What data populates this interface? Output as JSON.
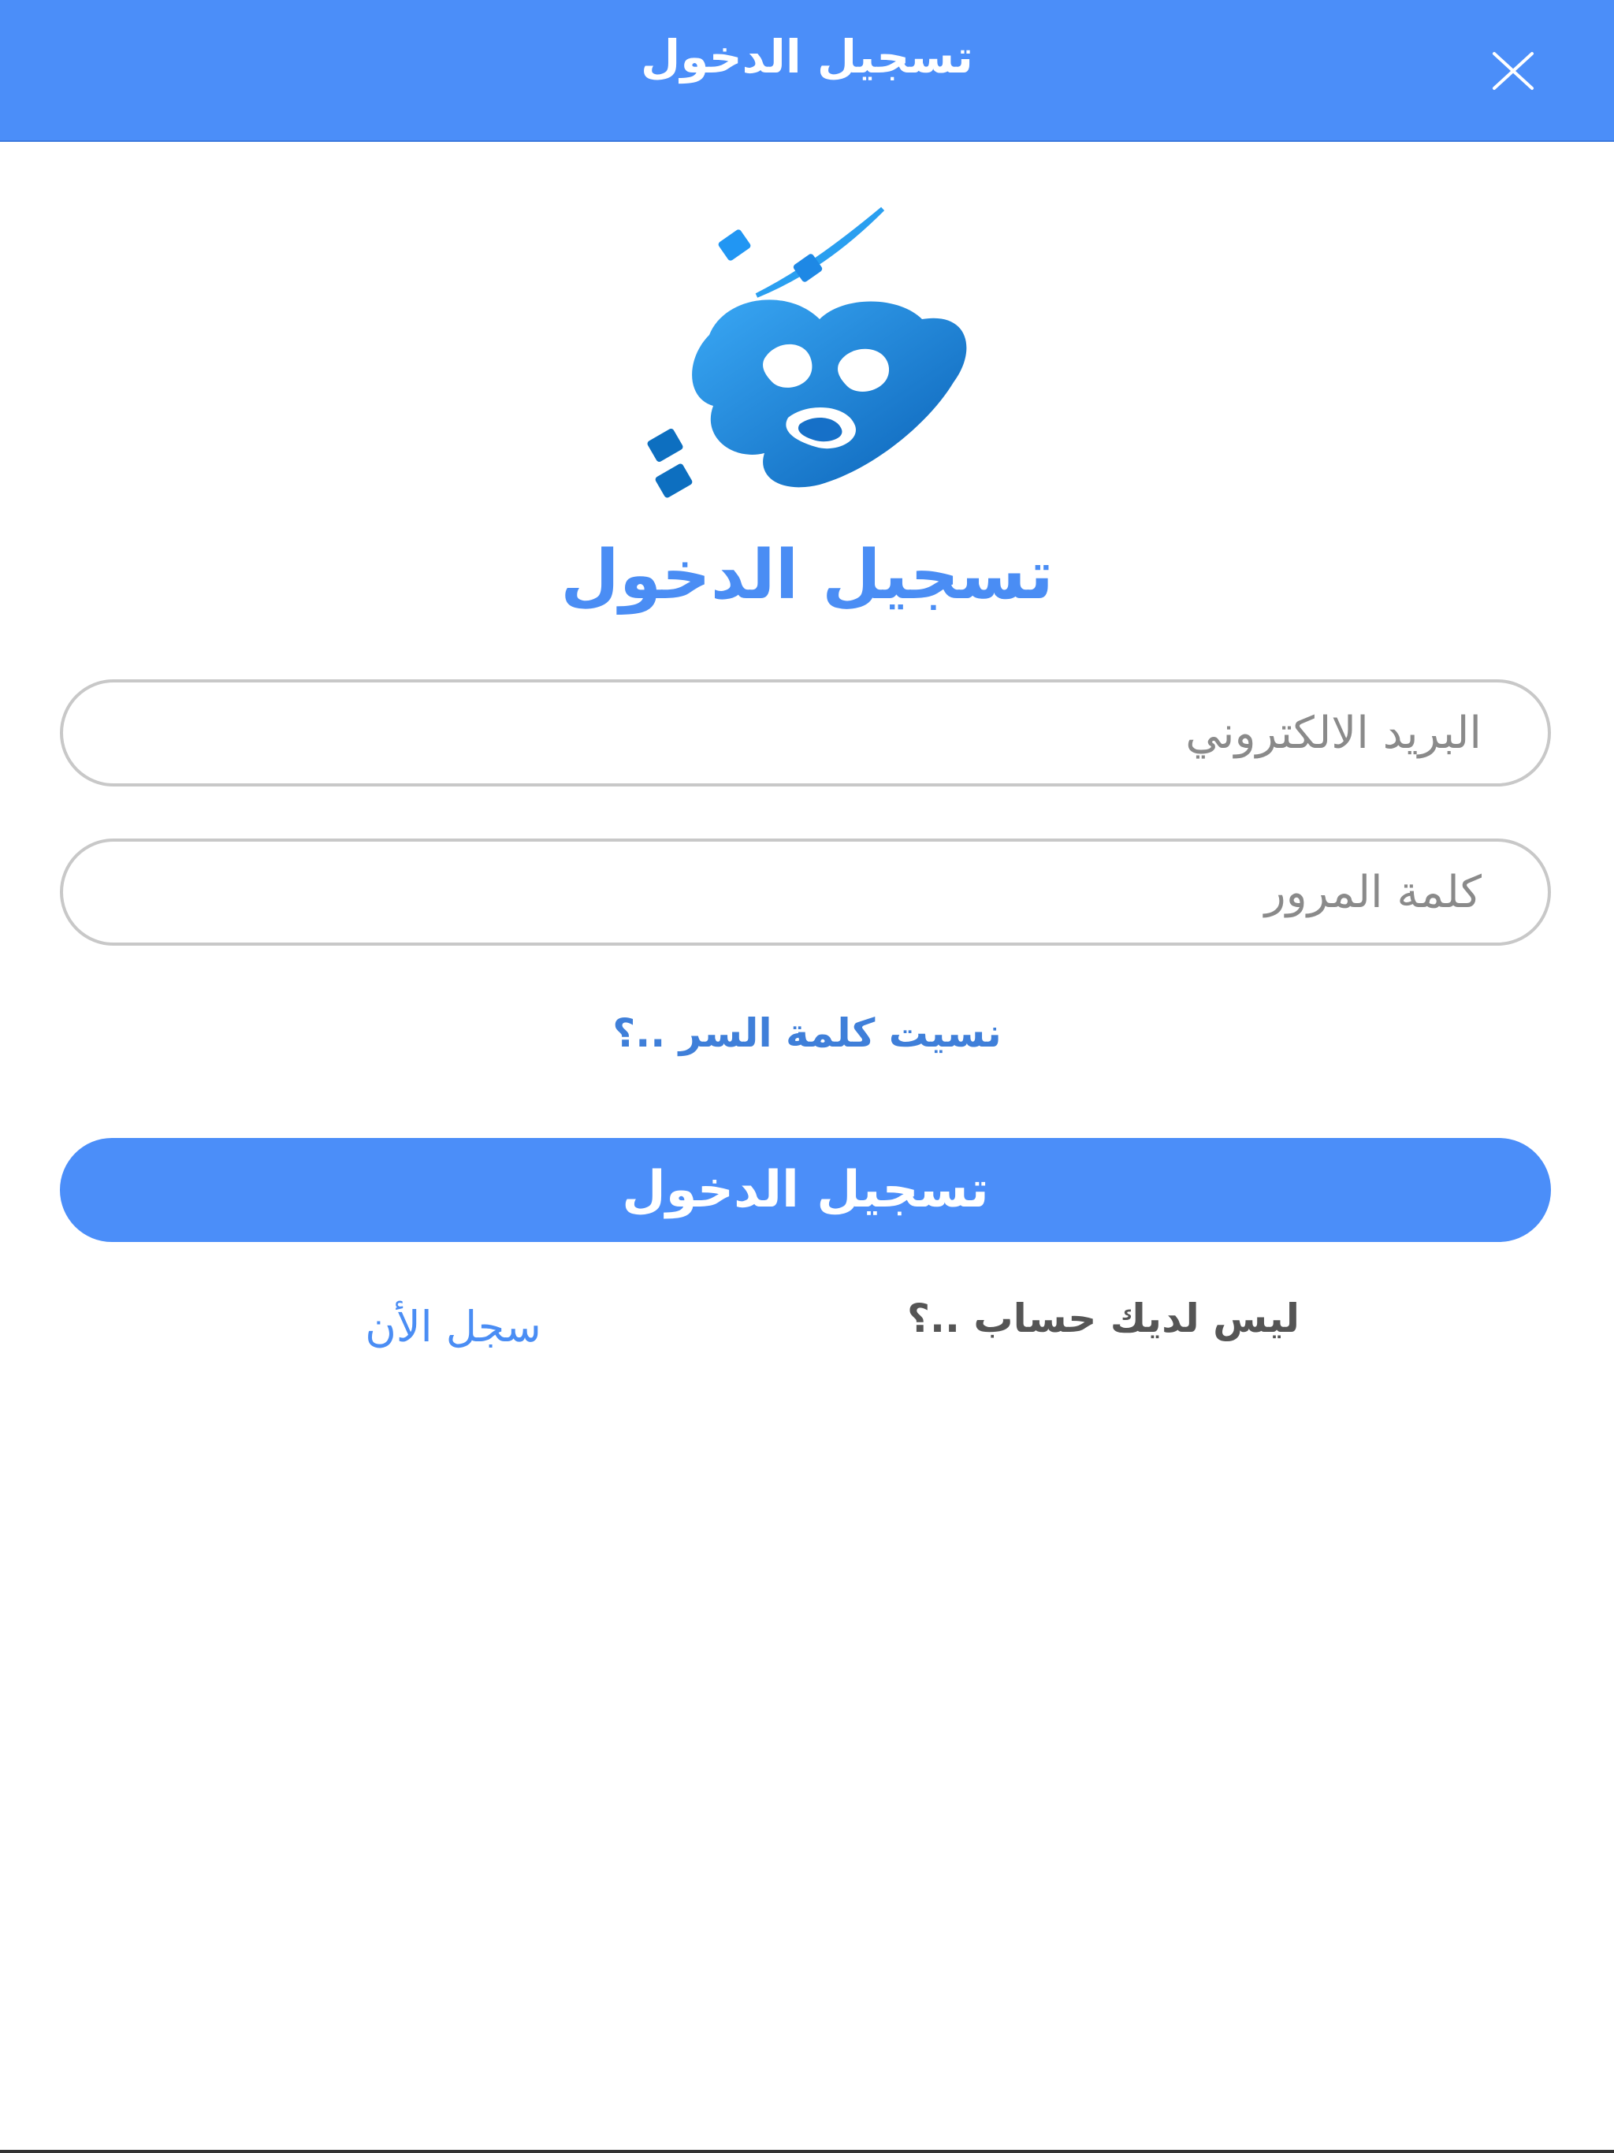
{
  "header": {
    "title": "تسجيل الدخول",
    "close_icon": "close-icon"
  },
  "logo": {
    "icon": "app-logo-calligraphy",
    "colors": [
      "#1e88e5",
      "#0d6fc0",
      "#2aa1f0"
    ]
  },
  "page_title": "تسجيل الدخول",
  "form": {
    "email_placeholder": "البريد الالكتروني",
    "email_value": "",
    "password_placeholder": "كلمة المرور",
    "password_value": "",
    "forgot_password": "نسيت كلمة السر ..؟",
    "login_button": "تسجيل الدخول"
  },
  "footer": {
    "no_account": "ليس لديك حساب ..؟",
    "register_now": "سجل الأن"
  },
  "colors": {
    "accent": "#4b8ef9",
    "link": "#3f7fd9",
    "border": "#c8c8c8",
    "placeholder": "#8a8a8a"
  }
}
